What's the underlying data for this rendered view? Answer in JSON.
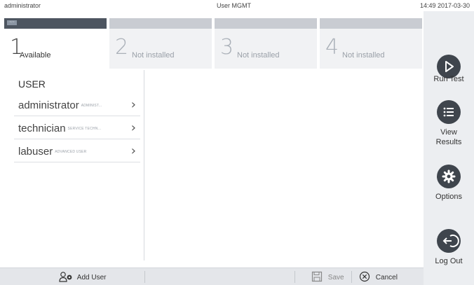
{
  "status_bar": {
    "user": "administrator",
    "title": "User MGMT",
    "datetime": "14:49 2017-03-30"
  },
  "tabs": [
    {
      "number": "1",
      "label": "Available",
      "active": true
    },
    {
      "number": "2",
      "label": "Not installed",
      "active": false
    },
    {
      "number": "3",
      "label": "Not installed",
      "active": false
    },
    {
      "number": "4",
      "label": "Not installed",
      "active": false
    }
  ],
  "user_panel": {
    "header": "USER",
    "users": [
      {
        "name": "administrator",
        "role": "ADMINIST..."
      },
      {
        "name": "technician",
        "role": "SERVICE TECHN..."
      },
      {
        "name": "labuser",
        "role": "ADVANCED USER"
      }
    ]
  },
  "side_menu": {
    "run_test": "Run Test",
    "view_results_line1": "View",
    "view_results_line2": "Results",
    "options": "Options",
    "log_out": "Log Out",
    "icons": {
      "run_test": "play-icon",
      "view_results": "list-icon",
      "options": "gear-icon",
      "log_out": "logout-arrow-icon"
    }
  },
  "toolbar": {
    "add_user": "Add User",
    "save": "Save",
    "cancel": "Cancel",
    "icons": {
      "add_user": "add-user-icon",
      "save": "save-icon",
      "cancel": "cancel-icon"
    }
  },
  "colors": {
    "accent_dark": "#3f454d",
    "side_bg": "#eceef1",
    "toolbar_bg": "#e4e6ea"
  }
}
